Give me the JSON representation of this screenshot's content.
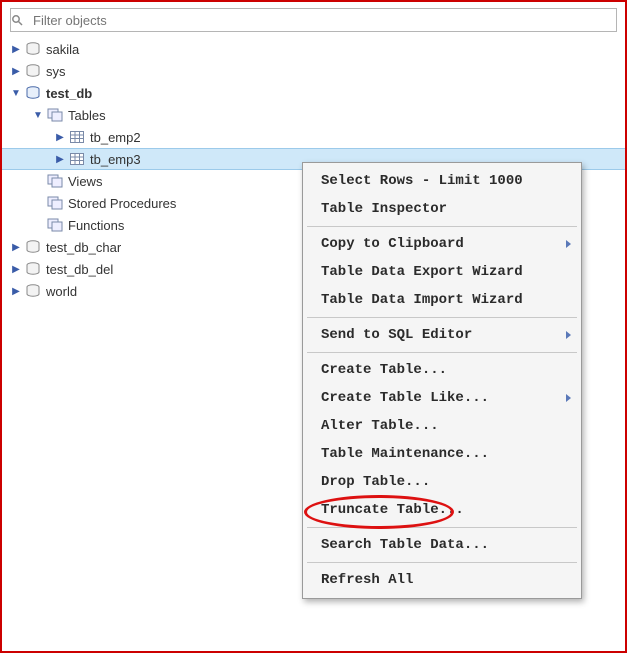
{
  "filter": {
    "placeholder": "Filter objects"
  },
  "tree": {
    "sakila": "sakila",
    "sys": "sys",
    "test_db": "test_db",
    "tables": "Tables",
    "tb_emp2": "tb_emp2",
    "tb_emp3": "tb_emp3",
    "views": "Views",
    "stored_procedures": "Stored Procedures",
    "functions": "Functions",
    "test_db_char": "test_db_char",
    "test_db_del": "test_db_del",
    "world": "world"
  },
  "menu": {
    "select_rows": "Select Rows - Limit 1000",
    "table_inspector": "Table Inspector",
    "copy_clipboard": "Copy to Clipboard",
    "export_wizard": "Table Data Export Wizard",
    "import_wizard": "Table Data Import Wizard",
    "send_sql": "Send to SQL Editor",
    "create_table": "Create Table...",
    "create_like": "Create Table Like...",
    "alter_table": "Alter Table...",
    "table_maintenance": "Table Maintenance...",
    "drop_table": "Drop Table...",
    "truncate_table": "Truncate Table...",
    "search_table_data": "Search Table Data...",
    "refresh_all": "Refresh All"
  }
}
